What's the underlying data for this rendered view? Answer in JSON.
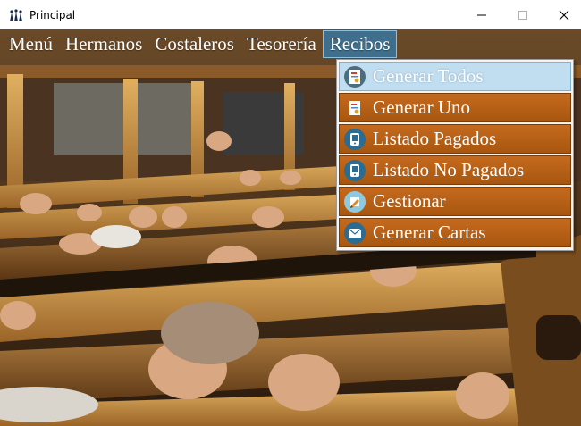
{
  "window": {
    "title": "Principal"
  },
  "menubar": {
    "items": [
      {
        "label": "Menú"
      },
      {
        "label": "Hermanos"
      },
      {
        "label": "Costaleros"
      },
      {
        "label": "Tesorería"
      },
      {
        "label": "Recibos"
      }
    ]
  },
  "recibos_menu": {
    "items": [
      {
        "label": "Generar Todos",
        "icon": "document-icon"
      },
      {
        "label": "Generar Uno",
        "icon": "document-icon"
      },
      {
        "label": "Listado Pagados",
        "icon": "phone-icon"
      },
      {
        "label": "Listado No Pagados",
        "icon": "phone-icon"
      },
      {
        "label": "Gestionar",
        "icon": "pencil-icon"
      },
      {
        "label": "Generar Cartas",
        "icon": "envelope-icon"
      }
    ]
  },
  "background": {
    "description_colors": {
      "wood": "#c58a3e",
      "shadow": "#2a1a0d"
    }
  },
  "colors": {
    "menu_item_bg": "#b85f16",
    "menu_highlight": "#c0def0",
    "menubar_open": "#3f6f8c"
  }
}
